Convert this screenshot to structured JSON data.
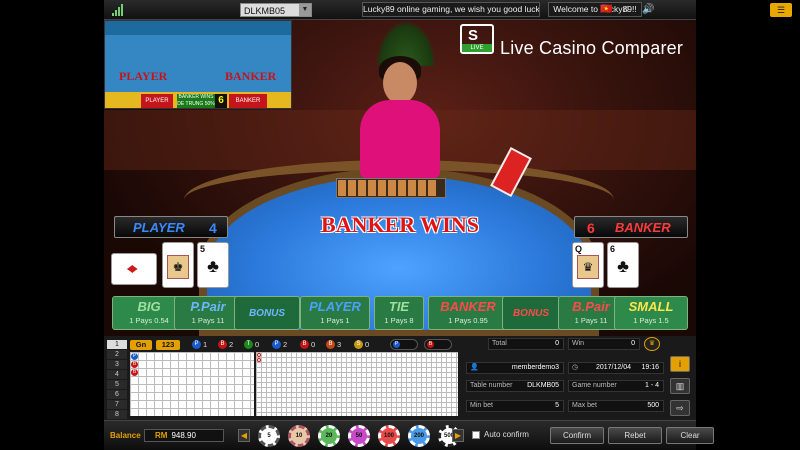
{
  "topbar": {
    "table_select": "DLKMB05",
    "marquee": "Lucky89 online gaming, we wish you good luck!",
    "welcome": "Welcome to Lucky89!!",
    "icons": [
      "language-flag-icon",
      "music-icon",
      "volume-icon",
      "menu-icon"
    ]
  },
  "watermark": {
    "logo_letter": "S",
    "logo_badge": "LIVE",
    "text": "Live Casino Comparer"
  },
  "inset": {
    "left_label": "PLAYER",
    "right_label": "BANKER",
    "bar_player": "PLAYER",
    "bar_mid": "BANKER WINS DE TRUNG 50%",
    "bar_num": "6",
    "bar_banker": "BANKER"
  },
  "result": "BANKER WINS",
  "player": {
    "label": "PLAYER",
    "score": "4"
  },
  "banker": {
    "label": "BANKER",
    "score": "6"
  },
  "player_cards": [
    {
      "rank": "",
      "suit": "♦",
      "red": true
    },
    {
      "rank": "",
      "suit": "♚",
      "red": false
    },
    {
      "rank": "5",
      "suit": "♣",
      "red": false
    }
  ],
  "banker_cards": [
    {
      "rank": "Q",
      "suit": "♛",
      "red": false
    },
    {
      "rank": "6",
      "suit": "♣",
      "red": false
    }
  ],
  "bets": [
    {
      "name": "BIG",
      "pay": "1 Pays 0.54",
      "bg": "#2e8a4a",
      "color": "#9fe09f"
    },
    {
      "name": "P.Pair",
      "pay": "1 Pays 11",
      "bg": "#2a7a44",
      "color": "#6fb6ff"
    },
    {
      "name": "BONUS",
      "pay": "",
      "bg": "#1f6a3a",
      "color": "#6fb6ff"
    },
    {
      "name": "PLAYER",
      "pay": "1 Pays 1",
      "bg": "#2a7a44",
      "color": "#4aa0ff"
    },
    {
      "name": "TIE",
      "pay": "1 Pays 8",
      "bg": "#2a7a44",
      "color": "#9fe09f"
    },
    {
      "name": "BANKER",
      "pay": "1 Pays 0.95",
      "bg": "#2a7a44",
      "color": "#ff4a4a"
    },
    {
      "name": "BONUS",
      "pay": "",
      "bg": "#1f6a3a",
      "color": "#ff4a4a"
    },
    {
      "name": "B.Pair",
      "pay": "1 Pays 11",
      "bg": "#2a7a44",
      "color": "#ff4a4a"
    },
    {
      "name": "SMALL",
      "pay": "1 Pays 1.5",
      "bg": "#2e8a4a",
      "color": "#ffe44a"
    }
  ],
  "road": {
    "rows": [
      "1",
      "2",
      "3",
      "4",
      "5",
      "6",
      "7",
      "8"
    ],
    "btn_gn": "Gn",
    "btn_123": "123",
    "stats": [
      {
        "letter": "P",
        "count": "1",
        "color": "#1a5acc"
      },
      {
        "letter": "B",
        "count": "2",
        "color": "#c41414"
      },
      {
        "letter": "T",
        "count": "0",
        "color": "#1a8a1a"
      },
      {
        "letter": "P",
        "count": "2",
        "color": "#1a5acc"
      },
      {
        "letter": "B",
        "count": "0",
        "color": "#c41414"
      },
      {
        "letter": "B",
        "count": "3",
        "color": "#c44a14"
      },
      {
        "letter": "S",
        "count": "0",
        "color": "#c49a14"
      }
    ],
    "pills": [
      {
        "letter": "P",
        "color": "#1a5acc"
      },
      {
        "letter": "B",
        "color": "#c41414"
      }
    ],
    "marks": [
      {
        "letter": "P",
        "color": "#1a5acc"
      },
      {
        "letter": "B",
        "color": "#c41414"
      },
      {
        "letter": "B",
        "color": "#c41414"
      }
    ]
  },
  "info": {
    "total_label": "Total",
    "total_value": "0",
    "win_label": "Win",
    "win_value": "0",
    "member": "memberdemo3",
    "date": "2017/12/04",
    "time": "19:16",
    "table_number_label": "Table number",
    "table_number": "DLKMB05",
    "game_number_label": "Game number",
    "game_number": "1 - 4",
    "min_bet_label": "Min bet",
    "min_bet": "5",
    "max_bet_label": "Max bet",
    "max_bet": "500"
  },
  "bottom": {
    "balance_label": "Balance",
    "currency": "RM",
    "balance": "948.90",
    "chips": [
      {
        "value": "5",
        "color": "#e8e8e8"
      },
      {
        "value": "10",
        "color": "#e8c8a8"
      },
      {
        "value": "20",
        "color": "#5ab85a"
      },
      {
        "value": "50",
        "color": "#c84ac8"
      },
      {
        "value": "100",
        "color": "#e84a4a"
      },
      {
        "value": "200",
        "color": "#4a9ae8"
      },
      {
        "value": "500",
        "color": "#eeeeee"
      }
    ],
    "auto_confirm": "Auto confirm",
    "confirm": "Confirm",
    "rebet": "Rebet",
    "clear": "Clear"
  }
}
